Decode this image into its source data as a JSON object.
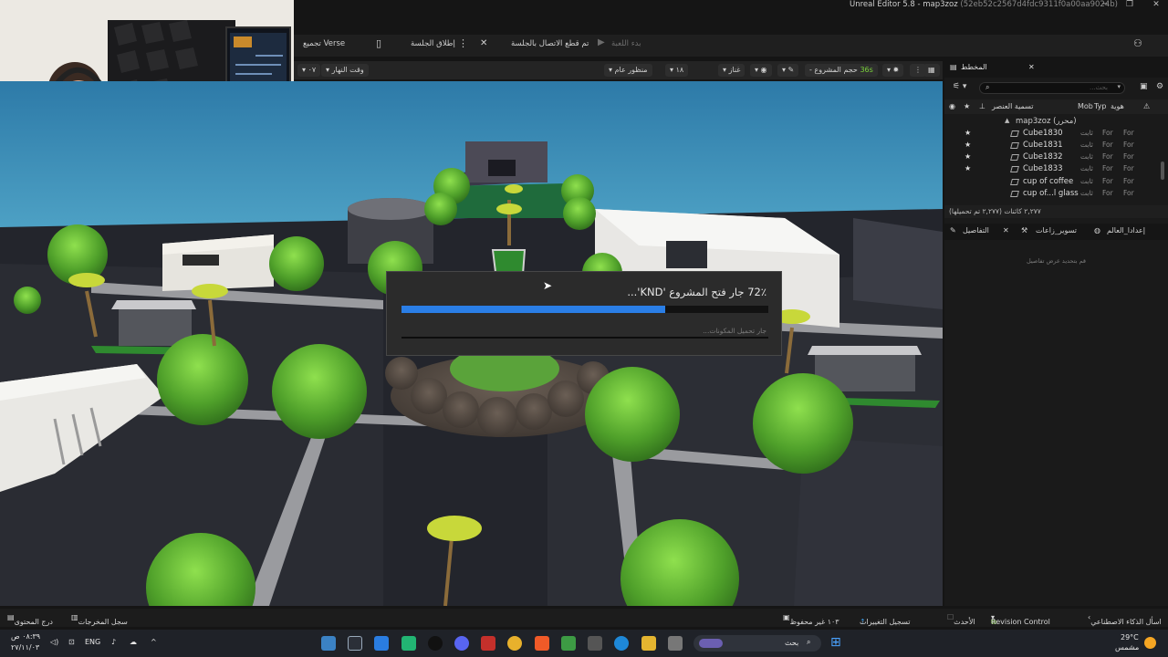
{
  "window": {
    "title": "Unreal Editor 5.8 - map3zoz",
    "hash": "(52eb52c2567d4fdc9311f0a00aa9024b)",
    "minimize": "─",
    "maximize": "❐",
    "close": "✕"
  },
  "toolbar": {
    "verse_label": "Verse تجميع",
    "launch_session": "إطلاق الجلسة",
    "disconnected": "تم قطع الاتصال بالجلسة",
    "start_game": "بدء اللعبة"
  },
  "viewport_header": {
    "time_of_day": "وقت النهار",
    "speed": "٠٧",
    "perspective": "منظور عام",
    "snap": "١٨",
    "view_mode": "غناز",
    "project_size_label": "حجم المشروع -",
    "fps": "36",
    "fps_unit": "s"
  },
  "dialog": {
    "percent": "72٪",
    "message": "جار فتح المشروع 'KND'...",
    "progress": 0.72,
    "sub_message": "جار تحميل المكونات..."
  },
  "outliner": {
    "tab_label": "المخطط",
    "search_placeholder": "بحث...",
    "col_name": "تسمية العنصر",
    "col_type": "Typ",
    "col_mob": "Mob",
    "col_id": "هوية",
    "map_row": "map3zoz (محرر)",
    "rows": [
      {
        "name": "Cube1830",
        "starred": "★",
        "t1": "ثابت",
        "t2": "For",
        "t3": "For"
      },
      {
        "name": "Cube1831",
        "starred": "★",
        "t1": "ثابت",
        "t2": "For",
        "t3": "For"
      },
      {
        "name": "Cube1832",
        "starred": "★",
        "t1": "ثابت",
        "t2": "For",
        "t3": "For"
      },
      {
        "name": "Cube1833",
        "starred": "★",
        "t1": "ثابت",
        "t2": "For",
        "t3": "For"
      },
      {
        "name": "cup of coffee",
        "starred": "",
        "t1": "ثابت",
        "t2": "For",
        "t3": "For"
      },
      {
        "name": "cup of...l glass",
        "starred": "",
        "t1": "ثابت",
        "t2": "For",
        "t3": "For"
      }
    ],
    "count": "٢,٢٧٧ كائنات (٢,٢٧٧ تم تحميلها)"
  },
  "details": {
    "tab_details": "التفاصيل",
    "tab_devices": "تسوير_زاعات",
    "tab_world": "إعدادا_العالم",
    "hint": "قم بتحديد عرض تفاصيل"
  },
  "statusbar": {
    "content_drawer": "درج المحتوى",
    "output_log": "سجل المخرجات",
    "unsaved": "١٠٣ غير محفوظ",
    "submit": "تسجيل التغييرات",
    "latest": "الأحدث",
    "revision": "Revision Control",
    "ai": "اسأل الذكاء الاصطناعي"
  },
  "taskbar": {
    "weather": "29°C",
    "weather_text": "مشمس",
    "search": "بحث",
    "lang": "ENG",
    "time": "٠٨:٣٩ ص",
    "date": "٢٧/١١/٠٣"
  },
  "colors": {
    "accent_blue": "#2a7ee6",
    "fps_green": "#7bd33b"
  }
}
